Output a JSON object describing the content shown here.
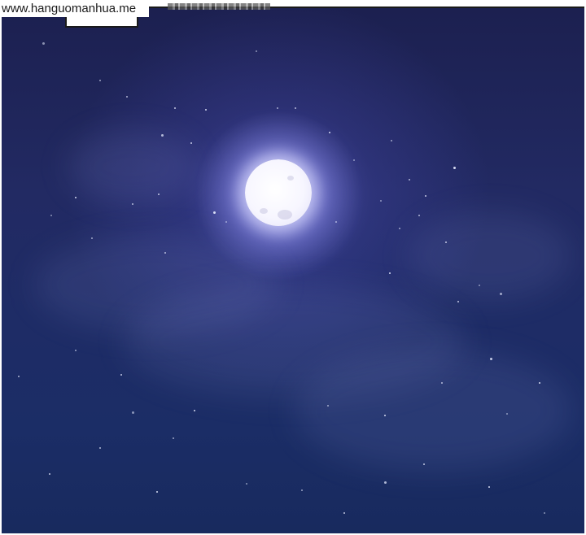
{
  "watermark": {
    "text": "www.hanguomanhua.me"
  },
  "scene": {
    "sky_color": "#1e2a63",
    "moon_color": "#ffffff",
    "glow_color": "#8a8ae6"
  }
}
